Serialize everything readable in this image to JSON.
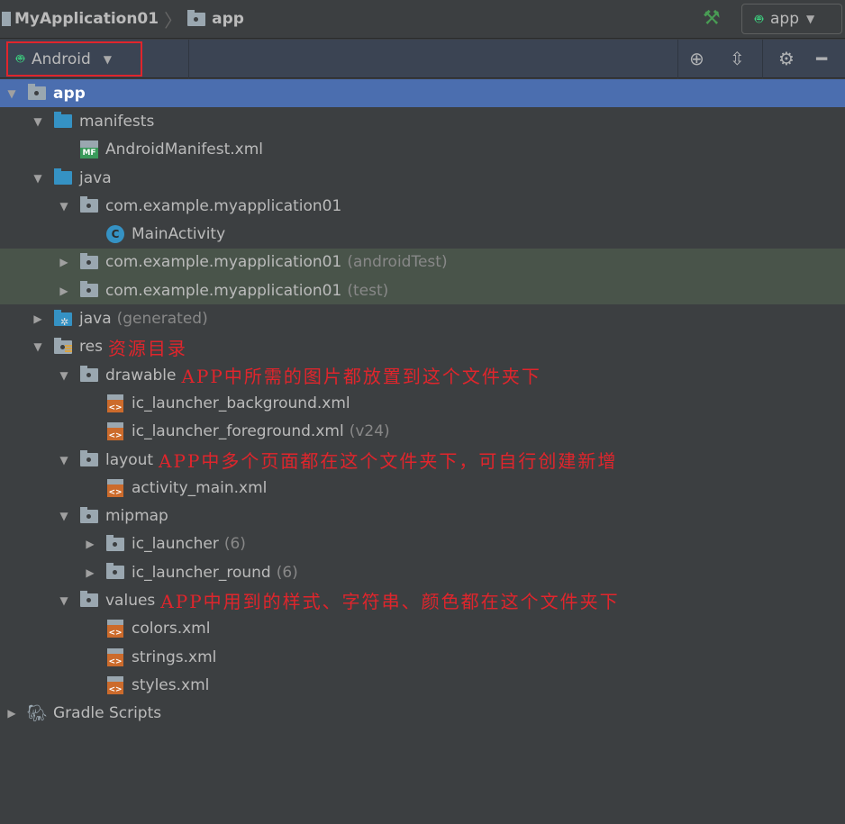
{
  "breadcrumb": {
    "project": "MyApplication01",
    "module": "app"
  },
  "run_config": {
    "label": "app"
  },
  "view_selector": {
    "label": "Android"
  },
  "colors": {
    "selection": "#4b6eaf",
    "annotation": "#e0252c",
    "test_bg": "#49544a"
  },
  "tree": [
    {
      "level": 0,
      "arrow": "down",
      "icon": "module",
      "label": "app",
      "sel": true
    },
    {
      "level": 1,
      "arrow": "down",
      "icon": "folder",
      "label": "manifests"
    },
    {
      "level": 2,
      "arrow": "",
      "icon": "mf",
      "label": "AndroidManifest.xml"
    },
    {
      "level": 1,
      "arrow": "down",
      "icon": "folder",
      "label": "java"
    },
    {
      "level": 2,
      "arrow": "down",
      "icon": "pkg",
      "label": "com.example.myapplication01"
    },
    {
      "level": 3,
      "arrow": "",
      "icon": "class",
      "label": "MainActivity"
    },
    {
      "level": 2,
      "arrow": "right",
      "icon": "pkg",
      "label": "com.example.myapplication01",
      "suffix": "(androidTest)",
      "test": true
    },
    {
      "level": 2,
      "arrow": "right",
      "icon": "pkg",
      "label": "com.example.myapplication01",
      "suffix": "(test)",
      "test": true
    },
    {
      "level": 1,
      "arrow": "right",
      "icon": "folder-gen",
      "label": "java",
      "suffix": "(generated)"
    },
    {
      "level": 1,
      "arrow": "down",
      "icon": "res",
      "label": "res",
      "note": "资源目录"
    },
    {
      "level": 2,
      "arrow": "down",
      "icon": "pkg",
      "label": "drawable",
      "note": "APP中所需的图片都放置到这个文件夹下"
    },
    {
      "level": 3,
      "arrow": "",
      "icon": "xml",
      "label": "ic_launcher_background.xml"
    },
    {
      "level": 3,
      "arrow": "",
      "icon": "xml",
      "label": "ic_launcher_foreground.xml",
      "suffix": "(v24)"
    },
    {
      "level": 2,
      "arrow": "down",
      "icon": "pkg",
      "label": "layout",
      "note": "APP中多个页面都在这个文件夹下，可自行创建新增"
    },
    {
      "level": 3,
      "arrow": "",
      "icon": "xml",
      "label": "activity_main.xml"
    },
    {
      "level": 2,
      "arrow": "down",
      "icon": "pkg",
      "label": "mipmap"
    },
    {
      "level": 3,
      "arrow": "right",
      "icon": "pkg",
      "label": "ic_launcher",
      "suffix": "(6)"
    },
    {
      "level": 3,
      "arrow": "right",
      "icon": "pkg",
      "label": "ic_launcher_round",
      "suffix": "(6)"
    },
    {
      "level": 2,
      "arrow": "down",
      "icon": "pkg",
      "label": "values",
      "note": "APP中用到的样式、字符串、颜色都在这个文件夹下"
    },
    {
      "level": 3,
      "arrow": "",
      "icon": "xml",
      "label": "colors.xml"
    },
    {
      "level": 3,
      "arrow": "",
      "icon": "xml",
      "label": "strings.xml"
    },
    {
      "level": 3,
      "arrow": "",
      "icon": "xml",
      "label": "styles.xml"
    },
    {
      "level": 0,
      "arrow": "right",
      "icon": "gradle",
      "label": "Gradle Scripts"
    }
  ]
}
